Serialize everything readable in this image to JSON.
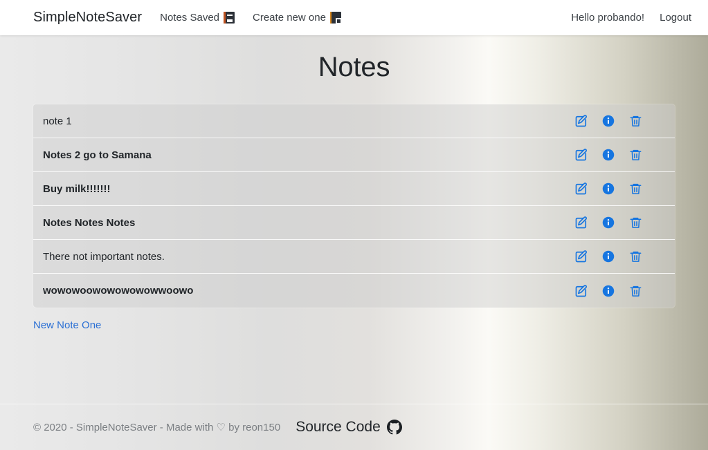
{
  "navbar": {
    "brand": "SimpleNoteSaver",
    "links": [
      {
        "label": "Notes Saved",
        "icon": "notebook-icon"
      },
      {
        "label": "Create new one",
        "icon": "memo-icon"
      }
    ],
    "greeting": "Hello probando!",
    "logout": "Logout"
  },
  "main": {
    "title": "Notes",
    "notes": [
      {
        "title": "note 1",
        "bold": false
      },
      {
        "title": "Notes 2 go to Samana",
        "bold": true
      },
      {
        "title": "Buy milk!!!!!!!",
        "bold": true
      },
      {
        "title": "Notes Notes Notes",
        "bold": true
      },
      {
        "title": "There not important notes.",
        "bold": false
      },
      {
        "title": "wowowoowowowowowwoowo",
        "bold": true
      }
    ],
    "row_actions": [
      {
        "name": "edit-icon",
        "title": "Edit"
      },
      {
        "name": "info-icon",
        "title": "Details"
      },
      {
        "name": "trash-icon",
        "title": "Delete"
      }
    ],
    "new_note_link": "New Note One"
  },
  "footer": {
    "text": "© 2020 - SimpleNoteSaver - Made with ♡ by reon150",
    "source_code_label": "Source Code",
    "source_code_icon": "github-icon"
  },
  "colors": {
    "accent_blue": "#1675e0",
    "link_blue": "#2a6fd4",
    "navbar_bg": "#ffffff",
    "gradient_left": "#eaeaea",
    "gradient_mid": "#fbfaf6",
    "gradient_right": "#adab9a",
    "row_bg": "#cdcdcd",
    "footer_text": "#7b7f83"
  }
}
